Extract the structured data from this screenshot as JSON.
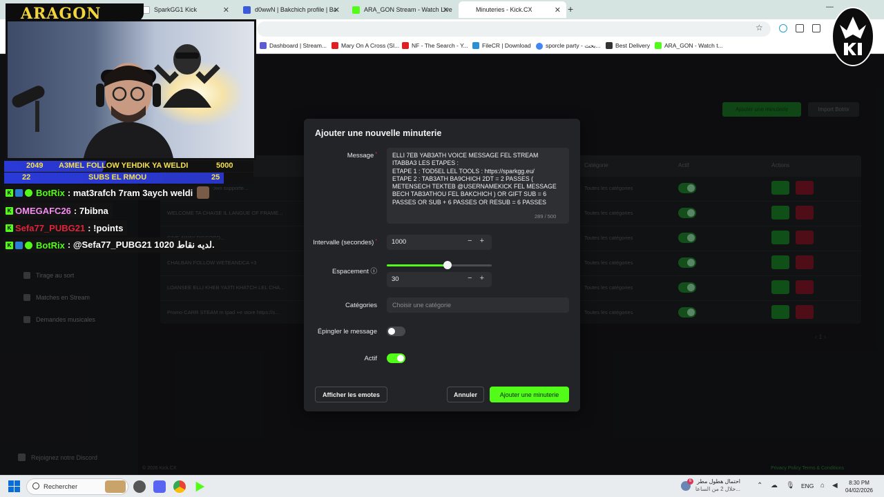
{
  "browser": {
    "tabs": [
      {
        "title": "SparkGG1 Kick",
        "favicon_color": "#ffffff"
      },
      {
        "title": "d0wwN | Bakchich profile | Bakc",
        "favicon_color": "#3b5bdb"
      },
      {
        "title": "ARA_GON Stream - Watch Live",
        "favicon_color": "#53fc18"
      },
      {
        "title": "Minuteries - Kick.CX",
        "favicon_color": "#ffffff"
      }
    ],
    "new_tab": "+",
    "bookmarks": [
      {
        "label": "Dashboard | Stream...",
        "favicon_color": "#5b5bd6"
      },
      {
        "label": "Mary On A Cross (Sl...",
        "favicon_color": "#e02020"
      },
      {
        "label": "NF - The Search - Y...",
        "favicon_color": "#e02020"
      },
      {
        "label": "FileCR | Download",
        "favicon_color": "#2b8fd6"
      },
      {
        "label": "sporcle party - بحث...",
        "favicon_color": "#4285f4"
      },
      {
        "label": "Best Delivery",
        "favicon_color": "#333333"
      },
      {
        "label": "ARA_GON - Watch t...",
        "favicon_color": "#53fc18"
      }
    ]
  },
  "app": {
    "sidebar": {
      "items": [
        "Tirage au sort",
        "Matches en Stream",
        "Demandes musicales"
      ],
      "discord": "Rejoignez notre Discord"
    },
    "copyright": "© 2026 Kick.CX",
    "footer_links": "Privacy Policy    Terms & Conditions",
    "add_timer_top": "Ajouter une minuterie",
    "import_bots": "Import Botrix",
    "table": {
      "headers": [
        "Catégorie",
        "Actif",
        "Actions"
      ],
      "rows": [
        {
          "message": "Chaque rejoindre crown supporte...",
          "category": "Toutes les catégories"
        },
        {
          "message": "WELCOME TA CHAISE IL LANGUE OF FRAME...",
          "category": "Toutes les catégories"
        },
        {
          "message": "GIVE AWAY DISCORD...",
          "category": "Toutes les catégories"
        },
        {
          "message": "CHALBAN FOLLOW WETEANDCA +3",
          "category": "Toutes les catégories"
        },
        {
          "message": "LOANSEE ELLI KHEB YA3TI KHATCH LEL CHA...",
          "category": "Toutes les catégories"
        },
        {
          "message": "Promo CARR STEAM m Ipad +e store https://s...",
          "category": "Toutes les catégories"
        }
      ]
    }
  },
  "modal": {
    "title": "Ajouter une nouvelle minuterie",
    "message_label": "Message",
    "message_value": "ELLI 7EB YAB3ATH VOICE MESSAGE FEL STREAM ITABBA3 LES ETAPES :\nETAPE 1 : TOD5EL LEL TOOLS : https://sparkgg.eu/\nETAPE 2 : TAB3ATH BA9CHICH 2DT = 2 PASSES ( METENSECH TEKTEB @USERNAMEKICK FEL MESSAGE BECH TAB3ATHOU FEL BAKCHICH ) OR GIFT SUB = 6 PASSES OR SUB + 6 PASSES OR RESUB = 6 PASSES",
    "message_count": "289 / 500",
    "interval_label": "Intervalle (secondes)",
    "interval_value": "1000",
    "spacing_label": "Espacement ⓘ",
    "spacing_value": "30",
    "spacing_slider_fraction": 0.58,
    "category_label": "Catégories",
    "category_placeholder": "Choisir une catégorie",
    "pin_label": "Épingler le message",
    "pin_on": false,
    "active_label": "Actif",
    "active_on": true,
    "emotes_button": "Afficher les emotes",
    "cancel_button": "Annuler",
    "submit_button": "Ajouter une minuterie",
    "required_mark": "*",
    "stepper": "− +"
  },
  "stream_overlay": {
    "logo": "ARAGON",
    "goals": [
      {
        "current": "2049",
        "text": "A3MEL FOLLOW YEHDIK YA WELDI",
        "target": "5000",
        "fill_fraction": 0.41
      },
      {
        "current": "22",
        "text": "SUBS EL RMOU",
        "target": "25",
        "fill_fraction": 0.88
      }
    ],
    "chat": [
      {
        "user": "BotRix",
        "user_color": "#53fc18",
        "message": ": mat3rafch 7ram 3aych weldi",
        "badges": [
          "kick",
          "bot",
          "verified"
        ]
      },
      {
        "user": "OMEGAFC26",
        "user_color": "#f58cf0",
        "message": ": 7bibna",
        "badges": [
          "kick"
        ]
      },
      {
        "user": "Sefa77_PUBG21",
        "user_color": "#e0233a",
        "message": ": !points",
        "badges": [
          "kick"
        ]
      },
      {
        "user": "BotRix",
        "user_color": "#53fc18",
        "message": ": @Sefa77_PUBG21 لديه نقاط 1020.",
        "badges": [
          "kick",
          "bot",
          "verified"
        ]
      }
    ]
  },
  "taskbar": {
    "search": "Rechercher",
    "weather_line1": "احتمال هطول مطر",
    "weather_line2": "خلال 2 من الساعا...",
    "weather_badge": "6",
    "lang": "ENG",
    "time": "8:30 PM",
    "date": "04/02/2026"
  },
  "colors": {
    "kick_green": "#53fc18",
    "modal_bg": "#222427",
    "danger": "#e0334d"
  }
}
